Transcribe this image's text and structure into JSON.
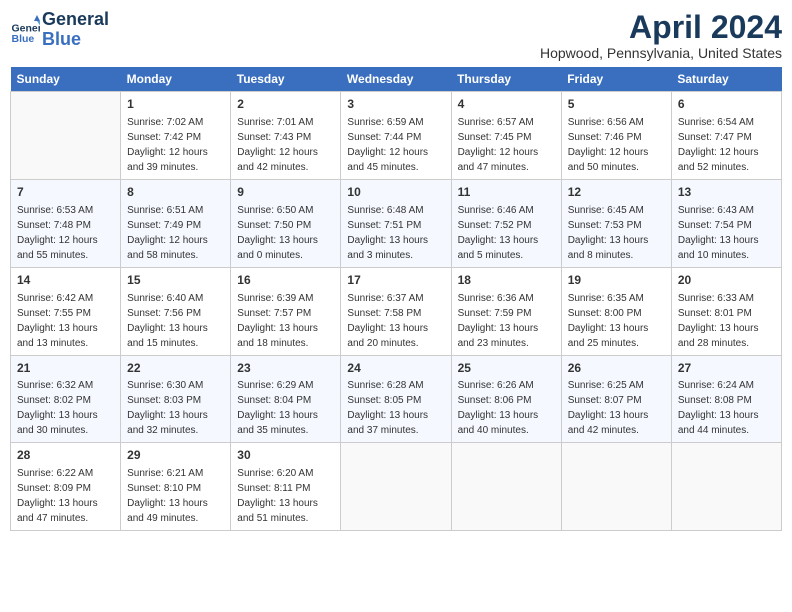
{
  "header": {
    "logo_line1": "General",
    "logo_line2": "Blue",
    "title": "April 2024",
    "location": "Hopwood, Pennsylvania, United States"
  },
  "weekdays": [
    "Sunday",
    "Monday",
    "Tuesday",
    "Wednesday",
    "Thursday",
    "Friday",
    "Saturday"
  ],
  "weeks": [
    [
      {
        "day": "",
        "info": ""
      },
      {
        "day": "1",
        "info": "Sunrise: 7:02 AM\nSunset: 7:42 PM\nDaylight: 12 hours\nand 39 minutes."
      },
      {
        "day": "2",
        "info": "Sunrise: 7:01 AM\nSunset: 7:43 PM\nDaylight: 12 hours\nand 42 minutes."
      },
      {
        "day": "3",
        "info": "Sunrise: 6:59 AM\nSunset: 7:44 PM\nDaylight: 12 hours\nand 45 minutes."
      },
      {
        "day": "4",
        "info": "Sunrise: 6:57 AM\nSunset: 7:45 PM\nDaylight: 12 hours\nand 47 minutes."
      },
      {
        "day": "5",
        "info": "Sunrise: 6:56 AM\nSunset: 7:46 PM\nDaylight: 12 hours\nand 50 minutes."
      },
      {
        "day": "6",
        "info": "Sunrise: 6:54 AM\nSunset: 7:47 PM\nDaylight: 12 hours\nand 52 minutes."
      }
    ],
    [
      {
        "day": "7",
        "info": "Sunrise: 6:53 AM\nSunset: 7:48 PM\nDaylight: 12 hours\nand 55 minutes."
      },
      {
        "day": "8",
        "info": "Sunrise: 6:51 AM\nSunset: 7:49 PM\nDaylight: 12 hours\nand 58 minutes."
      },
      {
        "day": "9",
        "info": "Sunrise: 6:50 AM\nSunset: 7:50 PM\nDaylight: 13 hours\nand 0 minutes."
      },
      {
        "day": "10",
        "info": "Sunrise: 6:48 AM\nSunset: 7:51 PM\nDaylight: 13 hours\nand 3 minutes."
      },
      {
        "day": "11",
        "info": "Sunrise: 6:46 AM\nSunset: 7:52 PM\nDaylight: 13 hours\nand 5 minutes."
      },
      {
        "day": "12",
        "info": "Sunrise: 6:45 AM\nSunset: 7:53 PM\nDaylight: 13 hours\nand 8 minutes."
      },
      {
        "day": "13",
        "info": "Sunrise: 6:43 AM\nSunset: 7:54 PM\nDaylight: 13 hours\nand 10 minutes."
      }
    ],
    [
      {
        "day": "14",
        "info": "Sunrise: 6:42 AM\nSunset: 7:55 PM\nDaylight: 13 hours\nand 13 minutes."
      },
      {
        "day": "15",
        "info": "Sunrise: 6:40 AM\nSunset: 7:56 PM\nDaylight: 13 hours\nand 15 minutes."
      },
      {
        "day": "16",
        "info": "Sunrise: 6:39 AM\nSunset: 7:57 PM\nDaylight: 13 hours\nand 18 minutes."
      },
      {
        "day": "17",
        "info": "Sunrise: 6:37 AM\nSunset: 7:58 PM\nDaylight: 13 hours\nand 20 minutes."
      },
      {
        "day": "18",
        "info": "Sunrise: 6:36 AM\nSunset: 7:59 PM\nDaylight: 13 hours\nand 23 minutes."
      },
      {
        "day": "19",
        "info": "Sunrise: 6:35 AM\nSunset: 8:00 PM\nDaylight: 13 hours\nand 25 minutes."
      },
      {
        "day": "20",
        "info": "Sunrise: 6:33 AM\nSunset: 8:01 PM\nDaylight: 13 hours\nand 28 minutes."
      }
    ],
    [
      {
        "day": "21",
        "info": "Sunrise: 6:32 AM\nSunset: 8:02 PM\nDaylight: 13 hours\nand 30 minutes."
      },
      {
        "day": "22",
        "info": "Sunrise: 6:30 AM\nSunset: 8:03 PM\nDaylight: 13 hours\nand 32 minutes."
      },
      {
        "day": "23",
        "info": "Sunrise: 6:29 AM\nSunset: 8:04 PM\nDaylight: 13 hours\nand 35 minutes."
      },
      {
        "day": "24",
        "info": "Sunrise: 6:28 AM\nSunset: 8:05 PM\nDaylight: 13 hours\nand 37 minutes."
      },
      {
        "day": "25",
        "info": "Sunrise: 6:26 AM\nSunset: 8:06 PM\nDaylight: 13 hours\nand 40 minutes."
      },
      {
        "day": "26",
        "info": "Sunrise: 6:25 AM\nSunset: 8:07 PM\nDaylight: 13 hours\nand 42 minutes."
      },
      {
        "day": "27",
        "info": "Sunrise: 6:24 AM\nSunset: 8:08 PM\nDaylight: 13 hours\nand 44 minutes."
      }
    ],
    [
      {
        "day": "28",
        "info": "Sunrise: 6:22 AM\nSunset: 8:09 PM\nDaylight: 13 hours\nand 47 minutes."
      },
      {
        "day": "29",
        "info": "Sunrise: 6:21 AM\nSunset: 8:10 PM\nDaylight: 13 hours\nand 49 minutes."
      },
      {
        "day": "30",
        "info": "Sunrise: 6:20 AM\nSunset: 8:11 PM\nDaylight: 13 hours\nand 51 minutes."
      },
      {
        "day": "",
        "info": ""
      },
      {
        "day": "",
        "info": ""
      },
      {
        "day": "",
        "info": ""
      },
      {
        "day": "",
        "info": ""
      }
    ]
  ]
}
